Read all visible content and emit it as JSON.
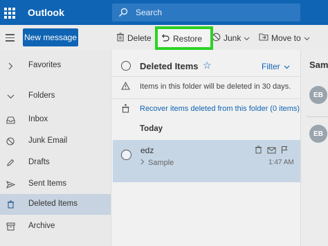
{
  "app": {
    "name": "Outlook"
  },
  "search": {
    "placeholder": "Search"
  },
  "toolbar": {
    "new_message": "New message",
    "delete": "Delete",
    "restore": "Restore",
    "junk": "Junk",
    "move_to": "Move to"
  },
  "nav": {
    "favorites": "Favorites",
    "folders": "Folders",
    "items": [
      {
        "label": "Inbox",
        "icon": "inbox-icon"
      },
      {
        "label": "Junk Email",
        "icon": "block-icon"
      },
      {
        "label": "Drafts",
        "icon": "pencil-icon"
      },
      {
        "label": "Sent Items",
        "icon": "send-icon"
      },
      {
        "label": "Deleted Items",
        "icon": "trash-icon",
        "active": true
      },
      {
        "label": "Archive",
        "icon": "archive-icon"
      }
    ]
  },
  "list": {
    "title": "Deleted Items",
    "filter": "Filter",
    "notice": "Items in this folder will be deleted in 30 days.",
    "recover_link": "Recover items deleted from this folder (0 items)",
    "group": "Today",
    "messages": [
      {
        "from": "edz",
        "subject": "Sample",
        "time": "1:47 AM"
      }
    ]
  },
  "reading": {
    "header": "Sam",
    "avatars": [
      "EB",
      "EB"
    ]
  },
  "colors": {
    "brand": "#0f64b3",
    "highlight": "#2bd225",
    "selected_row": "#c7d6e5"
  }
}
